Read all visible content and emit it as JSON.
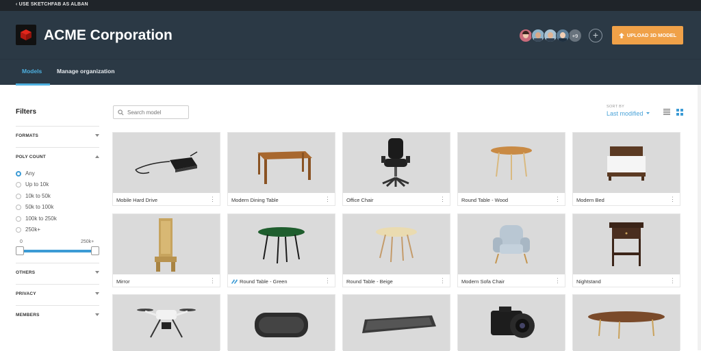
{
  "topbar": {
    "back_label": "‹ USE SKETCHFAB AS ALBAN"
  },
  "header": {
    "org_name": "ACME Corporation",
    "members_more": "+9",
    "add_member_label": "+",
    "upload_label": "UPLOAD 3D MODEL"
  },
  "tabs": [
    {
      "label": "Models",
      "active": true
    },
    {
      "label": "Manage organization",
      "active": false
    }
  ],
  "filters": {
    "title": "Filters",
    "formats": "FORMATS",
    "poly_count": "POLY COUNT",
    "poly_options": [
      "Any",
      "Up to 10k",
      "10k to 50k",
      "50k to 100k",
      "100k to 250k",
      "250k+"
    ],
    "poly_selected": "Any",
    "slider_min_label": "0",
    "slider_max_label": "250k+",
    "others": "OTHERS",
    "privacy": "PRIVACY",
    "members": "MEMBERS"
  },
  "search": {
    "placeholder": "Search model"
  },
  "sort": {
    "label": "SORT BY",
    "value": "Last modified"
  },
  "models": [
    {
      "name": "Mobile Hard Drive",
      "icon": "hard-drive"
    },
    {
      "name": "Modern Dining Table",
      "icon": "dining-table"
    },
    {
      "name": "Office Chair",
      "icon": "office-chair"
    },
    {
      "name": "Round Table - Wood",
      "icon": "round-table-wood"
    },
    {
      "name": "Modern Bed",
      "icon": "bed"
    },
    {
      "name": "Mirror",
      "icon": "mirror"
    },
    {
      "name": "Round Table - Green",
      "icon": "round-table-green",
      "badge": "sync-icon"
    },
    {
      "name": "Round Table - Beige",
      "icon": "round-table-beige"
    },
    {
      "name": "Modern Sofa Chair",
      "icon": "sofa-chair"
    },
    {
      "name": "Nightstand",
      "icon": "nightstand"
    },
    {
      "name": "",
      "icon": "drone"
    },
    {
      "name": "",
      "icon": "speaker"
    },
    {
      "name": "",
      "icon": "keyboard"
    },
    {
      "name": "",
      "icon": "camera"
    },
    {
      "name": "",
      "icon": "coffee-table"
    }
  ],
  "colors": {
    "header_bg": "#2b3945",
    "accent": "#4db0e0",
    "upload_btn": "#f0a148"
  }
}
